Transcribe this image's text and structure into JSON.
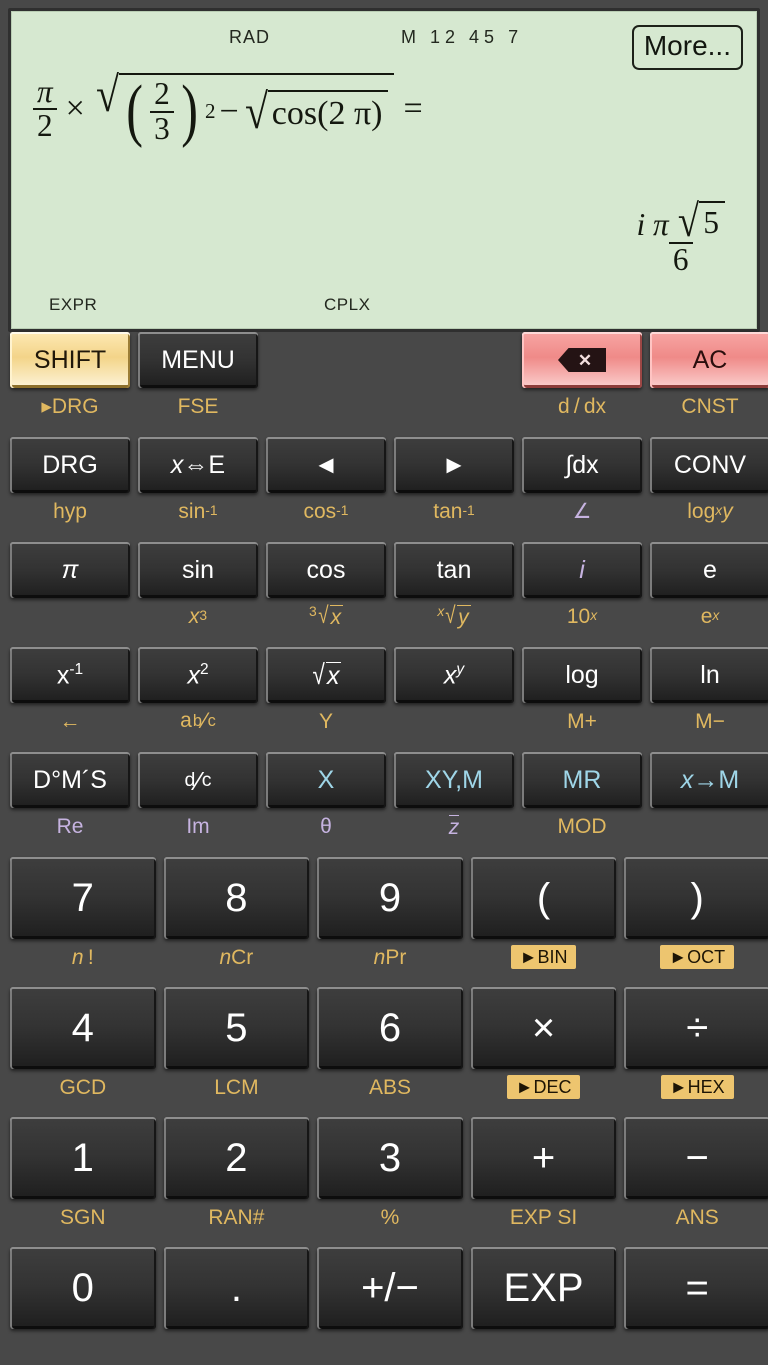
{
  "display": {
    "angle_mode": "RAD",
    "memory_indicator": "M",
    "memory_slots": [
      "1 2",
      "4 5",
      "7"
    ],
    "more_button": "More...",
    "expression": {
      "text": "π/2 × √((2/3)² − √(cos(2 π))) =",
      "pi_num": "π",
      "pi_den": "2",
      "times": "×",
      "open_paren": "(",
      "inner_num": "2",
      "inner_den": "3",
      "close_paren": ")",
      "power": "2",
      "minus": "−",
      "cos_text": "cos(2 π)",
      "equals": "="
    },
    "result": {
      "text": "i π √5 / 6",
      "i": "i",
      "pi": "π",
      "radicand": "5",
      "denominator": "6"
    },
    "tag_left": "EXPR",
    "tag_center": "CPLX",
    "bg_color": "#d6e8d0",
    "text_color": "#14180f"
  },
  "colors": {
    "body": "#484848",
    "key_dark": "#333333",
    "key_shift": "#f3d489",
    "key_red": "#ef8a88",
    "sublabel_gold": "#e0b860",
    "sublabel_purple": "#c6b3e0",
    "label_cyan": "#9fd6e8",
    "boxed_bg": "#edc56f"
  },
  "keypad": {
    "rows": [
      {
        "type": "fn",
        "keys": [
          {
            "label": "SHIFT",
            "style": "shift",
            "sub": "►DRG",
            "sub_style": "gold"
          },
          {
            "label": "MENU",
            "style": "dark",
            "sub": "FSE",
            "sub_style": "gold"
          },
          {
            "label": "",
            "style": "spacer",
            "sub": "",
            "sub_style": "gold"
          },
          {
            "label": "",
            "style": "spacer",
            "sub": "",
            "sub_style": "gold"
          },
          {
            "label": "⌫",
            "style": "red-backspace",
            "sub": "d / dx",
            "sub_style": "gold"
          },
          {
            "label": "AC",
            "style": "red",
            "sub": "CNST",
            "sub_style": "gold"
          }
        ]
      },
      {
        "type": "fn",
        "keys": [
          {
            "label": "DRG",
            "style": "dark",
            "sub": "hyp",
            "sub_style": "gold"
          },
          {
            "label": "x⇔E",
            "style": "dark",
            "sub": "sin-1",
            "sub_style": "gold"
          },
          {
            "label": "◄",
            "style": "dark",
            "sub": "cos-1",
            "sub_style": "gold"
          },
          {
            "label": "►",
            "style": "dark",
            "sub": "tan-1",
            "sub_style": "gold"
          },
          {
            "label": "∫dx",
            "style": "dark",
            "sub": "∠",
            "sub_style": "purple"
          },
          {
            "label": "CONV",
            "style": "dark",
            "sub": "logx y",
            "sub_style": "gold"
          }
        ]
      },
      {
        "type": "fn",
        "keys": [
          {
            "label": "π",
            "style": "dark",
            "sub": "",
            "sub_style": "gold"
          },
          {
            "label": "sin",
            "style": "dark",
            "sub": "x3",
            "sub_style": "gold"
          },
          {
            "label": "cos",
            "style": "dark",
            "sub": "3√x",
            "sub_style": "gold"
          },
          {
            "label": "tan",
            "style": "dark",
            "sub": "x√y",
            "sub_style": "gold"
          },
          {
            "label": "i",
            "style": "dark-purple",
            "sub": "10x",
            "sub_style": "gold"
          },
          {
            "label": "e",
            "style": "dark",
            "sub": "ex",
            "sub_style": "gold"
          }
        ]
      },
      {
        "type": "fn",
        "keys": [
          {
            "label": "x-1",
            "style": "dark",
            "sub": "←",
            "sub_style": "gold"
          },
          {
            "label": "x2",
            "style": "dark",
            "sub": "a b/c",
            "sub_style": "gold"
          },
          {
            "label": "√x",
            "style": "dark",
            "sub": "Y",
            "sub_style": "gold"
          },
          {
            "label": "xy",
            "style": "dark",
            "sub": "",
            "sub_style": "gold"
          },
          {
            "label": "log",
            "style": "dark",
            "sub": "M+",
            "sub_style": "gold"
          },
          {
            "label": "ln",
            "style": "dark",
            "sub": "M−",
            "sub_style": "gold"
          }
        ]
      },
      {
        "type": "fn",
        "keys": [
          {
            "label": "D°M´S",
            "style": "dark",
            "sub": "Re",
            "sub_style": "purple"
          },
          {
            "label": "d/c",
            "style": "dark",
            "sub": "Im",
            "sub_style": "purple"
          },
          {
            "label": "X",
            "style": "dark-cyan",
            "sub": "θ",
            "sub_style": "purple"
          },
          {
            "label": "XY,M",
            "style": "dark-cyan",
            "sub": "z̄",
            "sub_style": "purple"
          },
          {
            "label": "MR",
            "style": "dark-cyan",
            "sub": "MOD",
            "sub_style": "gold"
          },
          {
            "label": "x→M",
            "style": "dark-cyan",
            "sub": "",
            "sub_style": "gold"
          }
        ]
      },
      {
        "type": "num",
        "keys": [
          {
            "label": "7",
            "style": "dark",
            "sub": "n !",
            "sub_style": "gold"
          },
          {
            "label": "8",
            "style": "dark",
            "sub": "nCr",
            "sub_style": "gold"
          },
          {
            "label": "9",
            "style": "dark",
            "sub": "nPr",
            "sub_style": "gold"
          },
          {
            "label": "(",
            "style": "dark",
            "sub": "►BIN",
            "sub_style": "boxed"
          },
          {
            "label": ")",
            "style": "dark",
            "sub": "►OCT",
            "sub_style": "boxed"
          }
        ]
      },
      {
        "type": "num",
        "keys": [
          {
            "label": "4",
            "style": "dark",
            "sub": "GCD",
            "sub_style": "gold"
          },
          {
            "label": "5",
            "style": "dark",
            "sub": "LCM",
            "sub_style": "gold"
          },
          {
            "label": "6",
            "style": "dark",
            "sub": "ABS",
            "sub_style": "gold"
          },
          {
            "label": "×",
            "style": "dark",
            "sub": "►DEC",
            "sub_style": "boxed"
          },
          {
            "label": "÷",
            "style": "dark",
            "sub": "►HEX",
            "sub_style": "boxed"
          }
        ]
      },
      {
        "type": "num",
        "keys": [
          {
            "label": "1",
            "style": "dark",
            "sub": "SGN",
            "sub_style": "gold"
          },
          {
            "label": "2",
            "style": "dark",
            "sub": "RAN#",
            "sub_style": "gold"
          },
          {
            "label": "3",
            "style": "dark",
            "sub": "%",
            "sub_style": "gold"
          },
          {
            "label": "+",
            "style": "dark",
            "sub": "EXP SI",
            "sub_style": "gold"
          },
          {
            "label": "−",
            "style": "dark",
            "sub": "ANS",
            "sub_style": "gold"
          }
        ]
      },
      {
        "type": "lastrow",
        "keys": [
          {
            "label": "0",
            "style": "dark",
            "sub": "",
            "sub_style": "gold"
          },
          {
            "label": ".",
            "style": "dark",
            "sub": "",
            "sub_style": "gold"
          },
          {
            "label": "+/−",
            "style": "dark",
            "sub": "",
            "sub_style": "gold"
          },
          {
            "label": "EXP",
            "style": "dark",
            "sub": "",
            "sub_style": "gold"
          },
          {
            "label": "=",
            "style": "dark",
            "sub": "",
            "sub_style": "gold"
          }
        ]
      }
    ]
  }
}
